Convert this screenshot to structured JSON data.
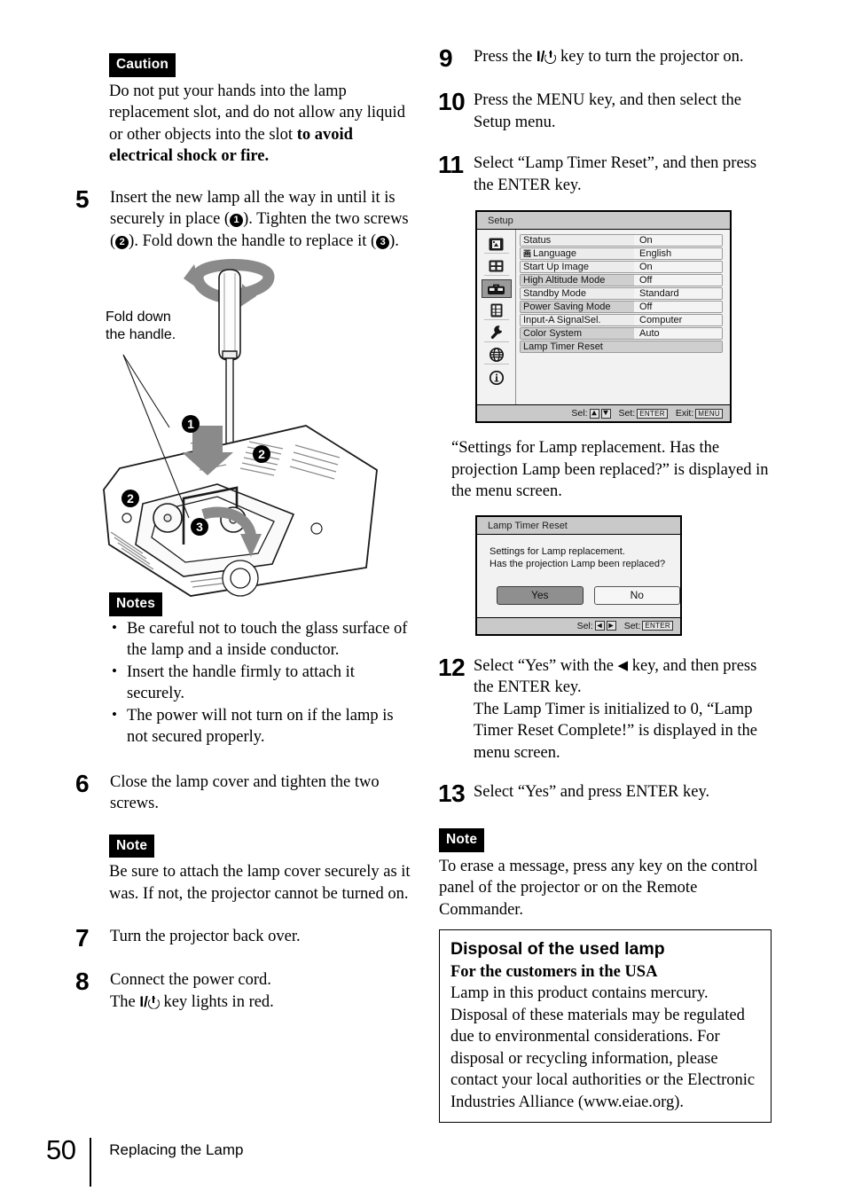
{
  "page": {
    "number": "50",
    "section": "Replacing the Lamp"
  },
  "left_column": {
    "caution": {
      "badge": "Caution",
      "text_1": "Do not put your hands into the lamp replacement slot, and do not allow any liquid or other objects into the slot ",
      "text_bold": "to avoid electrical shock or fire."
    },
    "step5": {
      "number": "5",
      "part_a": "Insert the new lamp all the way in until it is securely in place (",
      "c1": "1",
      "part_b": "). Tighten the two screws (",
      "c2": "2",
      "part_c": "). Fold down the handle to replace it (",
      "c3": "3",
      "part_d": ")."
    },
    "figure": {
      "callout": "Fold down\nthe handle.",
      "callout_line1": "Fold down",
      "callout_line2": "the handle.",
      "markers": [
        "1",
        "2",
        "2",
        "3"
      ]
    },
    "notes": {
      "badge": "Notes",
      "items": [
        "Be careful not to touch the glass surface of the lamp and a inside conductor.",
        "Insert the handle firmly to attach it securely.",
        "The power will not turn on if the lamp is not secured properly."
      ]
    },
    "step6": {
      "number": "6",
      "text": "Close the lamp cover and tighten the two screws."
    },
    "note_after_6": {
      "badge": "Note",
      "text": "Be sure to attach the lamp cover securely as it was. If not, the projector cannot be turned on."
    },
    "step7": {
      "number": "7",
      "text": "Turn the projector back over."
    },
    "step8": {
      "number": "8",
      "line1": "Connect the power cord.",
      "line2_pre": "The ",
      "line2_key": "I/",
      "line2_post": " key lights in red."
    }
  },
  "right_column": {
    "step9": {
      "number": "9",
      "pre": "Press the ",
      "key": "I/",
      "post": " key to turn the projector on."
    },
    "step10": {
      "number": "10",
      "text": "Press the MENU key, and then select the Setup menu."
    },
    "step11": {
      "number": "11",
      "text": "Select “Lamp Timer Reset”, and then press the ENTER key."
    },
    "setup_menu": {
      "title": "Setup",
      "icons": [
        "picture-icon",
        "screen-icon",
        "toolbox-icon",
        "list-icon",
        "wrench-icon",
        "globe-icon",
        "info-icon"
      ],
      "selected_icon_index": 2,
      "rows": [
        {
          "label": "Status",
          "value": "On",
          "shade": "light"
        },
        {
          "label": "Language",
          "value": "English",
          "shade": "light",
          "has_icon": true
        },
        {
          "label": "Start Up Image",
          "value": "On",
          "shade": "light"
        },
        {
          "label": "High Altitude Mode",
          "value": "Off",
          "shade": "dark"
        },
        {
          "label": "Standby Mode",
          "value": "Standard",
          "shade": "light"
        },
        {
          "label": "Power Saving Mode",
          "value": "Off",
          "shade": "dark"
        },
        {
          "label": "Input-A SignalSel.",
          "value": "Computer",
          "shade": "light"
        },
        {
          "label": "Color System",
          "value": "Auto",
          "shade": "dark"
        },
        {
          "label": "Lamp Timer Reset",
          "value": "",
          "shade": "dark",
          "full": true
        }
      ],
      "footer": {
        "sel_label": "Sel:",
        "set_label": "Set:",
        "set_key": "ENTER",
        "exit_label": "Exit:",
        "exit_key": "MENU"
      }
    },
    "menu_message": "“Settings for Lamp replacement. Has the projection Lamp been replaced?” is displayed in the menu screen.",
    "dialog": {
      "title": "Lamp Timer Reset",
      "line1": "Settings for Lamp replacement.",
      "line2": "Has the projection Lamp been replaced?",
      "yes_label": "Yes",
      "no_label": "No",
      "footer": {
        "sel_label": "Sel:",
        "set_label": "Set:",
        "set_key": "ENTER"
      }
    },
    "step12": {
      "number": "12",
      "pre": "Select “Yes” with the ",
      "arrow": "◀",
      "post": " key, and then press the ENTER key.",
      "detail": "The Lamp Timer is initialized to 0, “Lamp Timer Reset Complete!” is displayed in the menu screen."
    },
    "step13": {
      "number": "13",
      "text": "Select “Yes” and press ENTER key."
    },
    "note": {
      "badge": "Note",
      "text": "To erase a message, press any key on the control panel of the projector or on the Remote Commander."
    },
    "disposal": {
      "heading": "Disposal of the used lamp",
      "subheading": "For the customers in the USA",
      "body": "Lamp in this product contains mercury. Disposal of these materials may be regulated due to environmental considerations. For disposal or recycling information, please contact your local authorities or the Electronic Industries Alliance (www.eiae.org)."
    }
  }
}
